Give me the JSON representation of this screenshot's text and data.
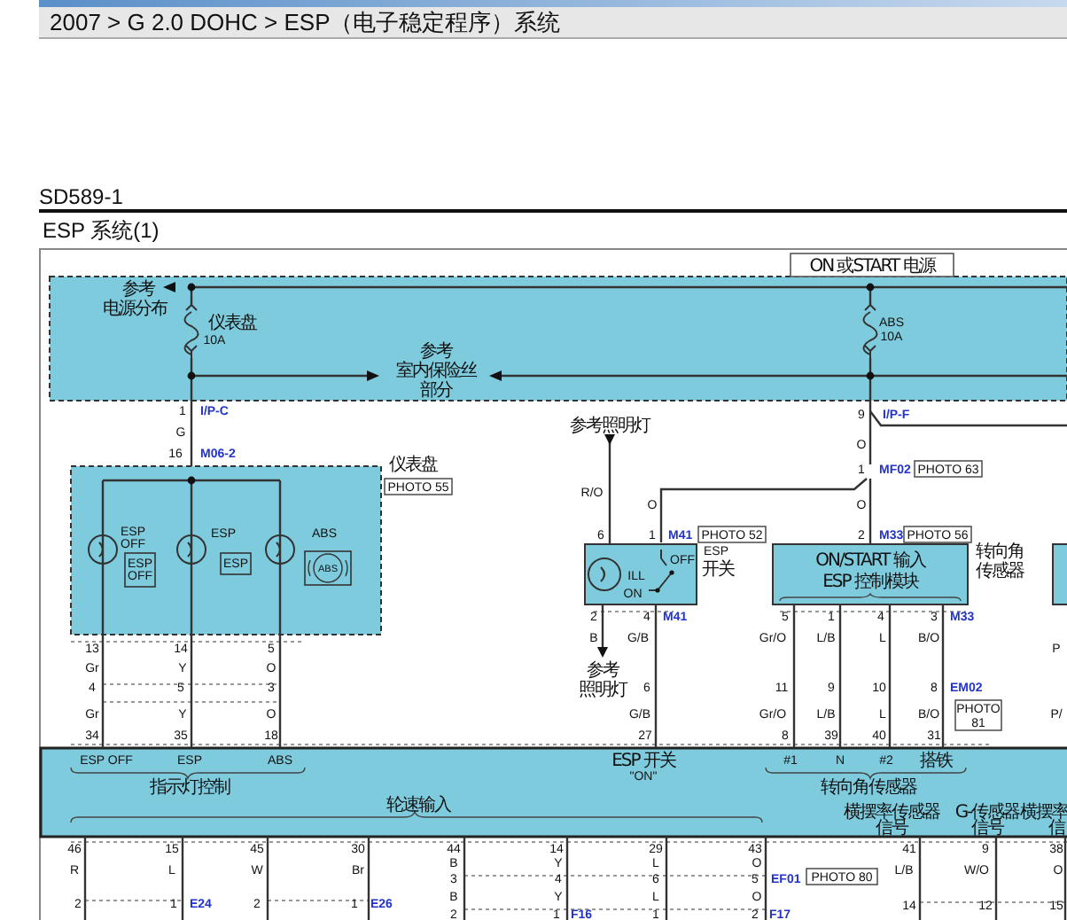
{
  "breadcrumb": "2007 > G 2.0 DOHC > ESP（电子稳定程序）系统",
  "diagram_code": "SD589-1",
  "diagram_title": "ESP 系统(1)",
  "diagram": {
    "labels": [
      {
        "kind": "notice",
        "text": "ON 或START 电源"
      },
      {
        "kind": "note",
        "text": "参考"
      },
      {
        "kind": "note",
        "text": "电源分布"
      },
      {
        "kind": "note",
        "text": "仪表盘"
      },
      {
        "kind": "text",
        "text": "10A"
      },
      {
        "kind": "text",
        "text": "ABS"
      },
      {
        "kind": "text",
        "text": "10A"
      },
      {
        "kind": "note",
        "text": "参考"
      },
      {
        "kind": "note",
        "text": "室内保险丝"
      },
      {
        "kind": "note",
        "text": "部分"
      },
      {
        "kind": "text",
        "text": "1"
      },
      {
        "kind": "connector",
        "text": "I/P-C"
      },
      {
        "kind": "text",
        "text": "G"
      },
      {
        "kind": "text",
        "text": "16"
      },
      {
        "kind": "connector",
        "text": "M06-2"
      },
      {
        "kind": "text",
        "text": "9"
      },
      {
        "kind": "connector",
        "text": "I/P-F"
      },
      {
        "kind": "note",
        "text": "参考照明灯"
      },
      {
        "kind": "text",
        "text": "O"
      },
      {
        "kind": "note",
        "text": "仪表盘"
      },
      {
        "kind": "tag",
        "text": "PHOTO 55"
      },
      {
        "kind": "text",
        "text": "1"
      },
      {
        "kind": "connector",
        "text": "MF02"
      },
      {
        "kind": "tag",
        "text": "PHOTO 63"
      },
      {
        "kind": "text",
        "text": "R/O"
      },
      {
        "kind": "text",
        "text": "O"
      },
      {
        "kind": "text",
        "text": "O"
      },
      {
        "kind": "text",
        "text": "6"
      },
      {
        "kind": "text",
        "text": "1"
      },
      {
        "kind": "connector",
        "text": "M41"
      },
      {
        "kind": "tag",
        "text": "PHOTO 52"
      },
      {
        "kind": "text",
        "text": "2"
      },
      {
        "kind": "connector",
        "text": "M33"
      },
      {
        "kind": "tag",
        "text": "PHOTO 56"
      },
      {
        "kind": "text",
        "text": "ILL"
      },
      {
        "kind": "text",
        "text": "ON"
      },
      {
        "kind": "text",
        "text": "OFF"
      },
      {
        "kind": "text",
        "text": "ESP"
      },
      {
        "kind": "note",
        "text": "开关"
      },
      {
        "kind": "note",
        "text": "转向角"
      },
      {
        "kind": "note",
        "text": "传感器"
      },
      {
        "kind": "note",
        "text": "ON/START 输入"
      },
      {
        "kind": "note",
        "text": "ESP 控制模块"
      },
      {
        "kind": "text",
        "text": "ESP"
      },
      {
        "kind": "text",
        "text": "OFF"
      },
      {
        "kind": "symbol",
        "lines": [
          "ESP",
          "OFF"
        ]
      },
      {
        "kind": "text",
        "text": "ESP"
      },
      {
        "kind": "symbol",
        "lines": [
          "ESP"
        ]
      },
      {
        "kind": "text",
        "text": "ABS"
      },
      {
        "kind": "badge",
        "text": "ABS"
      },
      {
        "kind": "text",
        "text": "13"
      },
      {
        "kind": "text",
        "text": "14"
      },
      {
        "kind": "text",
        "text": "5"
      },
      {
        "kind": "text",
        "text": "Gr"
      },
      {
        "kind": "text",
        "text": "Y"
      },
      {
        "kind": "text",
        "text": "O"
      },
      {
        "kind": "text",
        "text": "2"
      },
      {
        "kind": "text",
        "text": "4"
      },
      {
        "kind": "connector",
        "text": "M41"
      },
      {
        "kind": "text",
        "text": "B"
      },
      {
        "kind": "text",
        "text": "G/B"
      },
      {
        "kind": "note",
        "text": "参考"
      },
      {
        "kind": "note",
        "text": "照明灯"
      },
      {
        "kind": "text",
        "text": "5"
      },
      {
        "kind": "text",
        "text": "1"
      },
      {
        "kind": "text",
        "text": "4"
      },
      {
        "kind": "text",
        "text": "3"
      },
      {
        "kind": "connector",
        "text": "M33"
      },
      {
        "kind": "text",
        "text": "Gr/O"
      },
      {
        "kind": "text",
        "text": "L/B"
      },
      {
        "kind": "text",
        "text": "L"
      },
      {
        "kind": "text",
        "text": "B/O"
      },
      {
        "kind": "text",
        "text": "P"
      },
      {
        "kind": "text",
        "text": "4"
      },
      {
        "kind": "text",
        "text": "5"
      },
      {
        "kind": "text",
        "text": "3"
      },
      {
        "kind": "text",
        "text": "6"
      },
      {
        "kind": "text",
        "text": "11"
      },
      {
        "kind": "text",
        "text": "9"
      },
      {
        "kind": "text",
        "text": "10"
      },
      {
        "kind": "text",
        "text": "8"
      },
      {
        "kind": "connector",
        "text": "EM02"
      },
      {
        "kind": "text",
        "text": "Gr"
      },
      {
        "kind": "text",
        "text": "Y"
      },
      {
        "kind": "text",
        "text": "O"
      },
      {
        "kind": "text",
        "text": "G/B"
      },
      {
        "kind": "text",
        "text": "Gr/O"
      },
      {
        "kind": "text",
        "text": "L/B"
      },
      {
        "kind": "text",
        "text": "L"
      },
      {
        "kind": "text",
        "text": "B/O"
      },
      {
        "kind": "tag",
        "lines": [
          "PHOTO",
          "81"
        ]
      },
      {
        "kind": "text",
        "text": "P/"
      },
      {
        "kind": "text",
        "text": "34"
      },
      {
        "kind": "text",
        "text": "35"
      },
      {
        "kind": "text",
        "text": "18"
      },
      {
        "kind": "text",
        "text": "27"
      },
      {
        "kind": "text",
        "text": "8"
      },
      {
        "kind": "text",
        "text": "39"
      },
      {
        "kind": "text",
        "text": "40"
      },
      {
        "kind": "text",
        "text": "31"
      },
      {
        "kind": "text",
        "text": "ESP OFF"
      },
      {
        "kind": "text",
        "text": "ESP"
      },
      {
        "kind": "text",
        "text": "ABS"
      },
      {
        "kind": "note",
        "text": "指示灯控制"
      },
      {
        "kind": "note",
        "text": "ESP 开关"
      },
      {
        "kind": "text",
        "text": "\"ON\""
      },
      {
        "kind": "text",
        "text": "#1"
      },
      {
        "kind": "text",
        "text": "N"
      },
      {
        "kind": "text",
        "text": "#2"
      },
      {
        "kind": "note",
        "text": "搭铁"
      },
      {
        "kind": "note",
        "text": "转向角传感器"
      },
      {
        "kind": "note",
        "text": "轮速输入"
      },
      {
        "kind": "note",
        "text": "横摆率传感器"
      },
      {
        "kind": "note",
        "text": "信号"
      },
      {
        "kind": "note",
        "text": "G-传感器"
      },
      {
        "kind": "note",
        "text": "信号"
      },
      {
        "kind": "note",
        "text": "横摆率"
      },
      {
        "kind": "note",
        "text": "信"
      },
      {
        "kind": "text",
        "text": "46"
      },
      {
        "kind": "text",
        "text": "15"
      },
      {
        "kind": "text",
        "text": "45"
      },
      {
        "kind": "text",
        "text": "30"
      },
      {
        "kind": "text",
        "text": "44"
      },
      {
        "kind": "text",
        "text": "14"
      },
      {
        "kind": "text",
        "text": "29"
      },
      {
        "kind": "text",
        "text": "43"
      },
      {
        "kind": "text",
        "text": "41"
      },
      {
        "kind": "text",
        "text": "9"
      },
      {
        "kind": "text",
        "text": "38"
      },
      {
        "kind": "text",
        "text": "B"
      },
      {
        "kind": "text",
        "text": "Y"
      },
      {
        "kind": "text",
        "text": "L"
      },
      {
        "kind": "text",
        "text": "O"
      },
      {
        "kind": "text",
        "text": "R"
      },
      {
        "kind": "text",
        "text": "L"
      },
      {
        "kind": "text",
        "text": "W"
      },
      {
        "kind": "text",
        "text": "Br"
      },
      {
        "kind": "text",
        "text": "L/B"
      },
      {
        "kind": "text",
        "text": "W/O"
      },
      {
        "kind": "text",
        "text": "O"
      },
      {
        "kind": "text",
        "text": "3"
      },
      {
        "kind": "text",
        "text": "4"
      },
      {
        "kind": "text",
        "text": "6"
      },
      {
        "kind": "text",
        "text": "5"
      },
      {
        "kind": "connector",
        "text": "EF01"
      },
      {
        "kind": "tag",
        "text": "PHOTO 80"
      },
      {
        "kind": "text",
        "text": "B"
      },
      {
        "kind": "text",
        "text": "Y"
      },
      {
        "kind": "text",
        "text": "L"
      },
      {
        "kind": "text",
        "text": "O"
      },
      {
        "kind": "text",
        "text": "2"
      },
      {
        "kind": "text",
        "text": "1"
      },
      {
        "kind": "connector",
        "text": "E24"
      },
      {
        "kind": "text",
        "text": "2"
      },
      {
        "kind": "text",
        "text": "1"
      },
      {
        "kind": "connector",
        "text": "E26"
      },
      {
        "kind": "text",
        "text": "14"
      },
      {
        "kind": "text",
        "text": "12"
      },
      {
        "kind": "text",
        "text": "15"
      },
      {
        "kind": "text",
        "text": "2"
      },
      {
        "kind": "text",
        "text": "1"
      },
      {
        "kind": "connector",
        "text": "F16"
      },
      {
        "kind": "text",
        "text": "1"
      },
      {
        "kind": "text",
        "text": "2"
      },
      {
        "kind": "connector",
        "text": "F17"
      }
    ]
  }
}
